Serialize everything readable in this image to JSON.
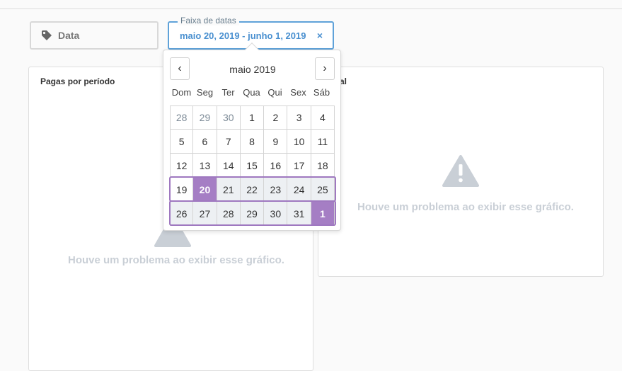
{
  "filters": {
    "data_label": "Data",
    "range_legend": "Faixa de datas",
    "range_value": "maio 20, 2019 - junho 1, 2019",
    "clear_symbol": "×"
  },
  "cards": {
    "left_title": "Pagas por período",
    "right_title": "tal",
    "error_message": "Houve um problema ao exibir esse gráfico."
  },
  "calendar": {
    "month_label": "maio 2019",
    "prev_symbol": "‹",
    "next_symbol": "›",
    "weekdays": [
      "Dom",
      "Seg",
      "Ter",
      "Qua",
      "Qui",
      "Sex",
      "Sáb"
    ],
    "weeks": [
      [
        "28",
        "29",
        "30",
        "1",
        "2",
        "3",
        "4"
      ],
      [
        "5",
        "6",
        "7",
        "8",
        "9",
        "10",
        "11"
      ],
      [
        "12",
        "13",
        "14",
        "15",
        "16",
        "17",
        "18"
      ],
      [
        "19",
        "20",
        "21",
        "22",
        "23",
        "24",
        "25"
      ],
      [
        "26",
        "27",
        "28",
        "29",
        "30",
        "31",
        "1"
      ]
    ],
    "muted_days": [
      [
        0,
        0
      ],
      [
        0,
        1
      ],
      [
        0,
        2
      ]
    ],
    "range_start": [
      3,
      1
    ],
    "range_end": [
      4,
      6
    ]
  },
  "colors": {
    "accent_blue": "#4a90d0",
    "range_purple": "#a57ec4",
    "error_grey": "#c9cfd6"
  },
  "icons": {
    "tag": "tag-icon",
    "clear": "close-icon",
    "prev": "chevron-left-icon",
    "next": "chevron-right-icon",
    "warning": "warning-icon"
  }
}
